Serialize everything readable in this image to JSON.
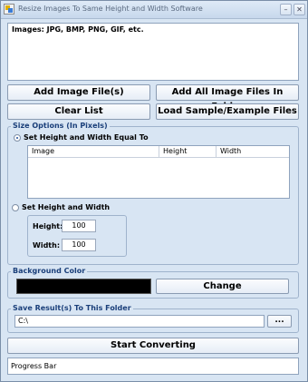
{
  "window": {
    "title": "Resize Images To Same Height and Width Software",
    "minimize_glyph": "–",
    "close_glyph": "✕"
  },
  "images_list": {
    "header": "Images: JPG, BMP, PNG, GIF, etc."
  },
  "buttons": {
    "add_image_files": "Add Image File(s)",
    "add_all_in_folder": "Add All Image Files In Folder",
    "clear_list": "Clear List",
    "load_sample": "Load Sample/Example Files",
    "change": "Change",
    "browse": "...",
    "start": "Start Converting"
  },
  "size_options": {
    "group_title": "Size Options (In Pixels)",
    "option_equal_label": "Set Height and Width Equal To",
    "option_equal_selected": true,
    "table_columns": [
      "Image",
      "Height",
      "Width"
    ],
    "option_set_label": "Set Height and Width",
    "height_label": "Height:",
    "height_value": "100",
    "width_label": "Width:",
    "width_value": "100"
  },
  "background": {
    "group_title": "Background Color",
    "color": "#000000"
  },
  "save": {
    "group_title": "Save Result(s) To This Folder",
    "path": "C:\\"
  },
  "progress": {
    "label": "Progress Bar"
  },
  "colors": {
    "window_bg": "#d8e5f3",
    "group_title": "#1a3f7a"
  }
}
